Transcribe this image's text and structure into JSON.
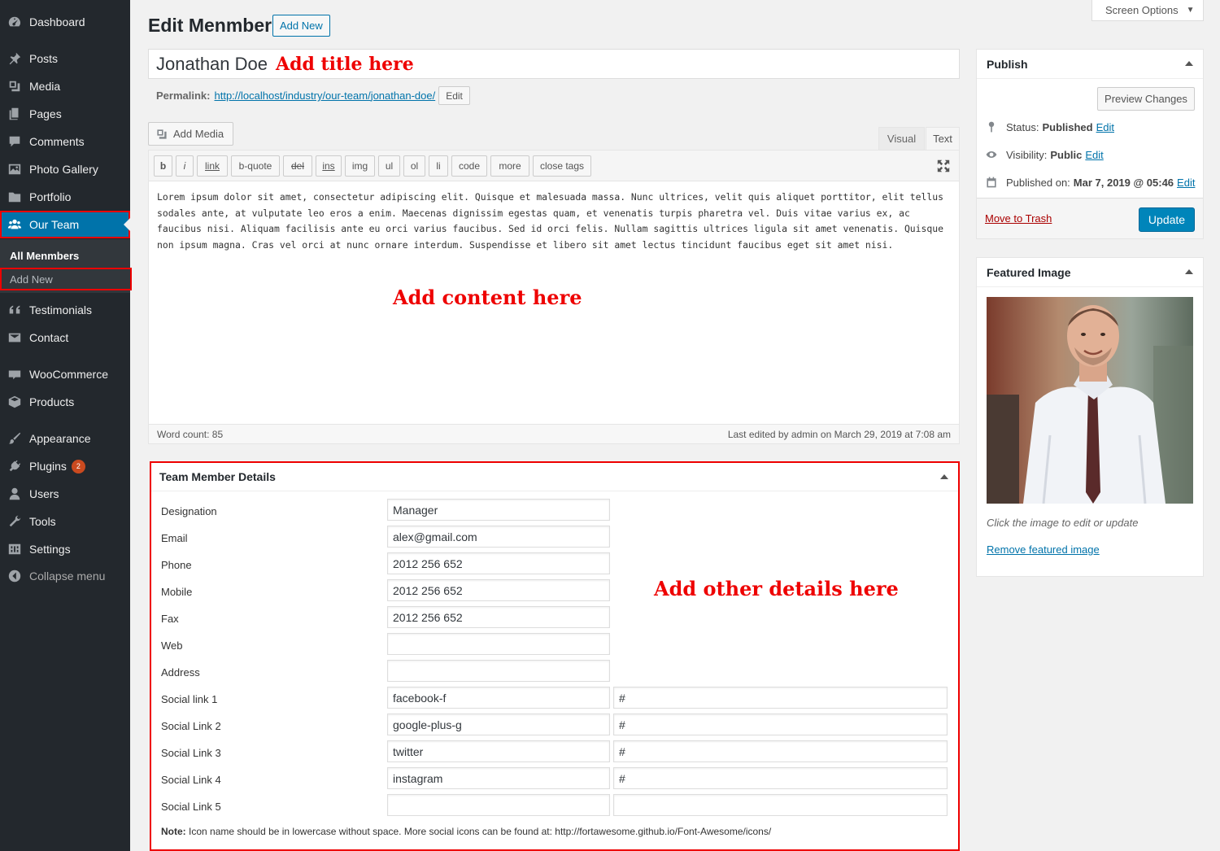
{
  "sidebar": {
    "items": [
      {
        "label": "Dashboard",
        "icon": "dashboard-icon"
      },
      {
        "label": "Posts",
        "icon": "pin-icon"
      },
      {
        "label": "Media",
        "icon": "media-icon"
      },
      {
        "label": "Pages",
        "icon": "pages-icon"
      },
      {
        "label": "Comments",
        "icon": "comment-icon"
      },
      {
        "label": "Photo Gallery",
        "icon": "gallery-icon"
      },
      {
        "label": "Portfolio",
        "icon": "folder-icon"
      },
      {
        "label": "Our Team",
        "icon": "team-icon"
      },
      {
        "label": "Testimonials",
        "icon": "quote-icon"
      },
      {
        "label": "Contact",
        "icon": "mail-icon"
      },
      {
        "label": "WooCommerce",
        "icon": "woo-icon"
      },
      {
        "label": "Products",
        "icon": "box-icon"
      },
      {
        "label": "Appearance",
        "icon": "brush-icon"
      },
      {
        "label": "Plugins",
        "icon": "plug-icon",
        "badge": "2"
      },
      {
        "label": "Users",
        "icon": "user-icon"
      },
      {
        "label": "Tools",
        "icon": "wrench-icon"
      },
      {
        "label": "Settings",
        "icon": "settings-icon"
      },
      {
        "label": "Collapse menu",
        "icon": "collapse-icon"
      }
    ],
    "submenu": [
      "All Menmbers",
      "Add New"
    ]
  },
  "header": {
    "screen_options": "Screen Options",
    "title": "Edit Menmber",
    "add_new": "Add New"
  },
  "post": {
    "title": "Jonathan Doe",
    "title_annotation": "Add title here",
    "permalink_label": "Permalink:",
    "permalink_base": "http://localhost/industry/our-team/",
    "permalink_slug": "jonathan-doe/",
    "permalink_edit": "Edit"
  },
  "editor": {
    "add_media": "Add Media",
    "tab_visual": "Visual",
    "tab_text": "Text",
    "quicktags": [
      "b",
      "i",
      "link",
      "b-quote",
      "del",
      "ins",
      "img",
      "ul",
      "ol",
      "li",
      "code",
      "more",
      "close tags"
    ],
    "content": "Lorem ipsum dolor sit amet, consectetur adipiscing elit. Quisque et malesuada massa. Nunc ultrices, velit quis aliquet porttitor, elit tellus sodales ante, at vulputate leo eros a enim. Maecenas dignissim egestas quam, et venenatis turpis pharetra vel. Duis vitae varius ex, ac faucibus nisi. Aliquam facilisis ante eu orci varius faucibus. Sed id orci felis. Nullam sagittis ultrices ligula sit amet venenatis. Quisque non ipsum magna. Cras vel orci at nunc ornare interdum. Suspendisse et libero sit amet lectus tincidunt faucibus eget sit amet nisi.",
    "content_annotation": "Add content here",
    "word_count": "Word count: 85",
    "last_edited": "Last edited by admin on March 29, 2019 at 7:08 am"
  },
  "team_details": {
    "heading": "Team Member Details",
    "annotation": "Add other details here",
    "fields": [
      {
        "label": "Designation",
        "value": "Manager"
      },
      {
        "label": "Email",
        "value": "alex@gmail.com"
      },
      {
        "label": "Phone",
        "value": "2012 256 652"
      },
      {
        "label": "Mobile",
        "value": "2012 256 652"
      },
      {
        "label": "Fax",
        "value": "2012 256 652"
      },
      {
        "label": "Web",
        "value": ""
      },
      {
        "label": "Address",
        "value": ""
      }
    ],
    "social": [
      {
        "label": "Social link 1",
        "icon": "facebook-f",
        "url": "#"
      },
      {
        "label": "Social Link 2",
        "icon": "google-plus-g",
        "url": "#"
      },
      {
        "label": "Social Link 3",
        "icon": "twitter",
        "url": "#"
      },
      {
        "label": "Social Link 4",
        "icon": "instagram",
        "url": "#"
      },
      {
        "label": "Social Link 5",
        "icon": "",
        "url": ""
      }
    ],
    "note_label": "Note:",
    "note_text": "Icon name should be in lowercase without space. More social icons can be found at: http://fortawesome.github.io/Font-Awesome/icons/"
  },
  "publish": {
    "heading": "Publish",
    "preview": "Preview Changes",
    "status_label": "Status:",
    "status_value": "Published",
    "visibility_label": "Visibility:",
    "visibility_value": "Public",
    "published_label": "Published on:",
    "published_value": "Mar 7, 2019 @ 05:46",
    "edit": "Edit",
    "trash": "Move to Trash",
    "update": "Update"
  },
  "featured_image": {
    "heading": "Featured Image",
    "help": "Click the image to edit or update",
    "remove": "Remove featured image"
  },
  "colors": {
    "sidebar_bg": "#23282d",
    "accent": "#0073aa",
    "annotation": "#e00000"
  }
}
